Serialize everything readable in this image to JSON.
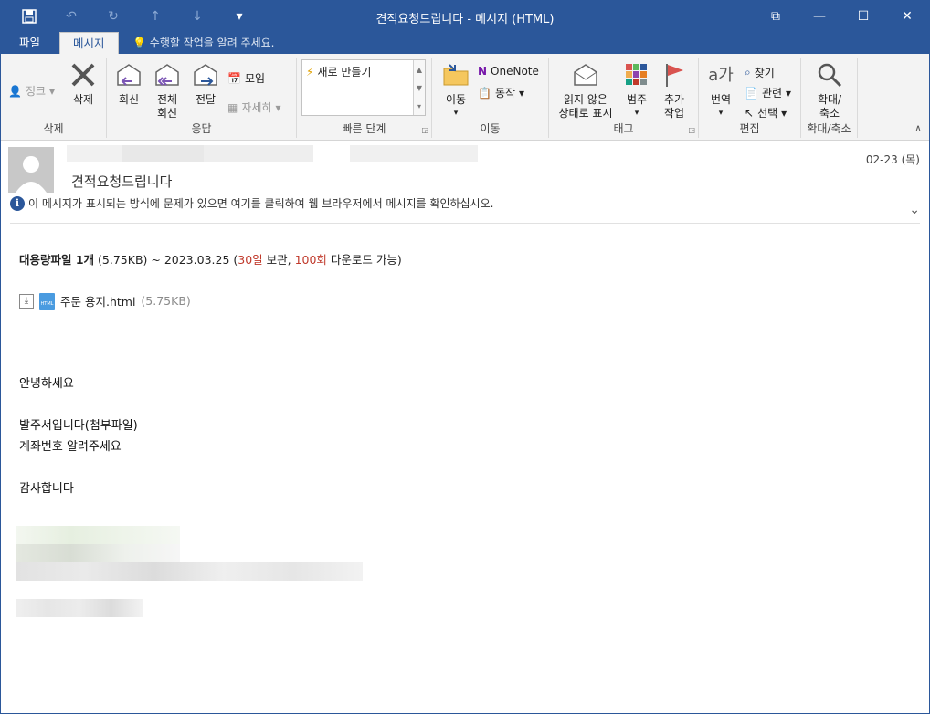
{
  "titlebar": {
    "title": "견적요청드립니다  -  메시지 (HTML)",
    "qat": {
      "save": "💾",
      "undo": "↶",
      "redo": "↻",
      "up": "↑",
      "down": "↓",
      "customize": "▾"
    },
    "controls": {
      "restore_icon": "⧉",
      "minimize": "—",
      "maximize": "☐",
      "close": "✕"
    }
  },
  "tabs": {
    "file": "파일",
    "message": "메시지",
    "tell_me": "수행할 작업을 알려 주세요."
  },
  "ribbon": {
    "groups": {
      "delete": {
        "label": "삭제",
        "ignore": "정크",
        "delete": "삭제"
      },
      "respond": {
        "label": "응답",
        "reply": "회신",
        "reply_all": "전체\n회신",
        "forward": "전달",
        "meeting": "모임",
        "more": "자세히"
      },
      "quick_steps": {
        "label": "빠른 단계",
        "new": "새로 만들기"
      },
      "move": {
        "label": "이동",
        "move": "이동",
        "onenote": "OneNote",
        "actions": "동작"
      },
      "tags": {
        "label": "태그",
        "mark_unread": "읽지 않은\n상태로 표시",
        "categorize": "범주",
        "follow_up": "추가\n작업"
      },
      "editing": {
        "label": "편집",
        "translate": "번역",
        "find": "찾기",
        "related": "관련",
        "select": "선택"
      },
      "zoom": {
        "label": "확대/축소",
        "zoom": "확대/\n축소"
      }
    }
  },
  "header": {
    "subject": "견적요청드립니다",
    "date": "02-23 (목)",
    "info_bar": "이 메시지가 표시되는 방식에 문제가 있으면 여기를 클릭하여 웹 브라우저에서 메시지를 확인하십시오."
  },
  "body": {
    "bigfile": {
      "title": "대용량파일 1개",
      "size": "(5.75KB) ~ 2023.03.25 (",
      "days": "30일",
      "keep": " 보관, ",
      "count": "100회",
      "download": " 다운로드 가능)"
    },
    "attachment": {
      "name": "주문 용지.html",
      "size": "(5.75KB)",
      "icon_text": "HTML"
    },
    "lines": [
      "안녕하세요",
      "발주서입니다(첨부파일)",
      "계좌번호 알려주세요",
      "감사합니다"
    ]
  },
  "colors": {
    "accent": "#2b579a",
    "highlight": "#c0392b"
  }
}
